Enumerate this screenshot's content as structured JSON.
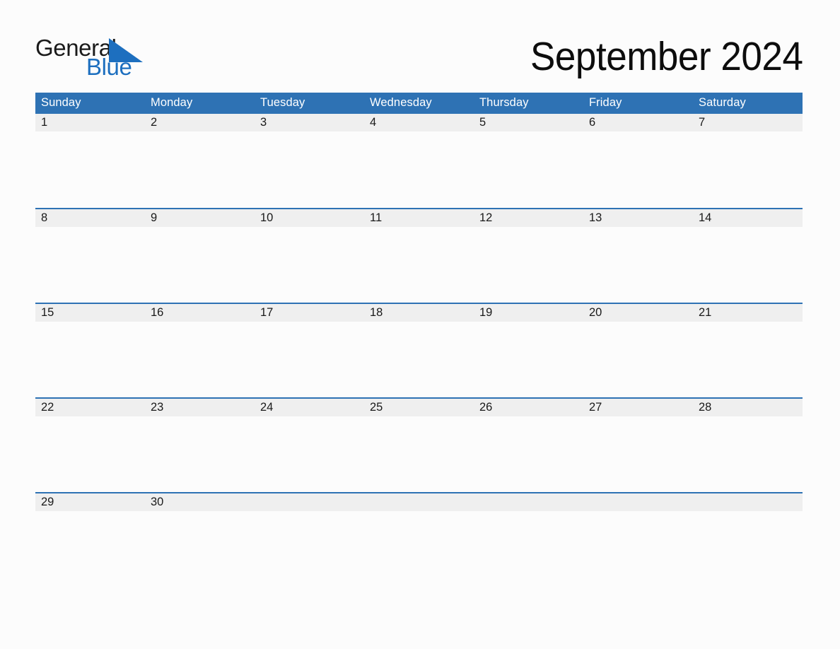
{
  "brand": {
    "name_part1": "General",
    "name_part2": "Blue",
    "triangle_icon": "triangle-icon",
    "accent_color": "#1d6fbf"
  },
  "header": {
    "title": "September 2024",
    "month": "September",
    "year": "2024"
  },
  "theme": {
    "header_blue": "#2e72b4",
    "day_band_grey": "#efefef",
    "page_background": "#fcfcfc",
    "text_color": "#1a1a1a",
    "header_text_color": "#ffffff"
  },
  "calendar": {
    "weekday_headers": [
      "Sunday",
      "Monday",
      "Tuesday",
      "Wednesday",
      "Thursday",
      "Friday",
      "Saturday"
    ],
    "weeks": [
      {
        "days": [
          {
            "number": "1"
          },
          {
            "number": "2"
          },
          {
            "number": "3"
          },
          {
            "number": "4"
          },
          {
            "number": "5"
          },
          {
            "number": "6"
          },
          {
            "number": "7"
          }
        ]
      },
      {
        "days": [
          {
            "number": "8"
          },
          {
            "number": "9"
          },
          {
            "number": "10"
          },
          {
            "number": "11"
          },
          {
            "number": "12"
          },
          {
            "number": "13"
          },
          {
            "number": "14"
          }
        ]
      },
      {
        "days": [
          {
            "number": "15"
          },
          {
            "number": "16"
          },
          {
            "number": "17"
          },
          {
            "number": "18"
          },
          {
            "number": "19"
          },
          {
            "number": "20"
          },
          {
            "number": "21"
          }
        ]
      },
      {
        "days": [
          {
            "number": "22"
          },
          {
            "number": "23"
          },
          {
            "number": "24"
          },
          {
            "number": "25"
          },
          {
            "number": "26"
          },
          {
            "number": "27"
          },
          {
            "number": "28"
          }
        ]
      },
      {
        "days": [
          {
            "number": "29"
          },
          {
            "number": "30"
          },
          {
            "number": ""
          },
          {
            "number": ""
          },
          {
            "number": ""
          },
          {
            "number": ""
          },
          {
            "number": ""
          }
        ]
      }
    ]
  }
}
